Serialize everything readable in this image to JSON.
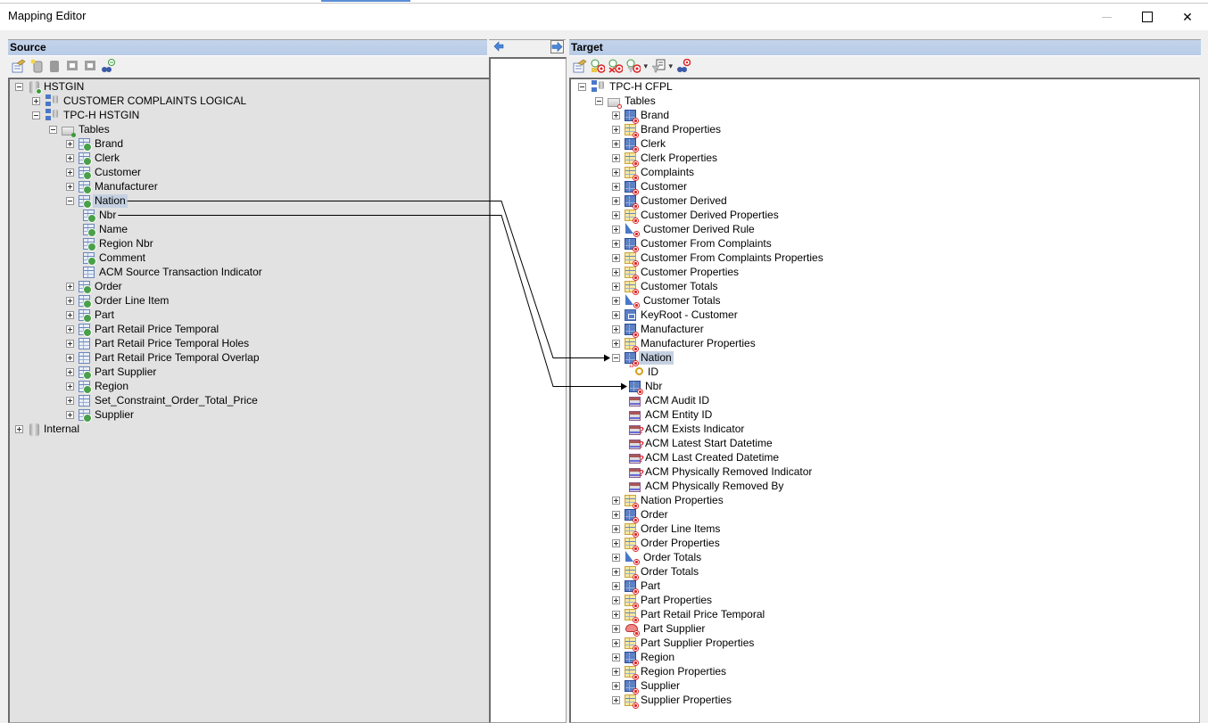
{
  "window": {
    "title": "Mapping Editor",
    "controls": {
      "minimize": "—",
      "maximize": "☐",
      "close": "✕"
    }
  },
  "source": {
    "header": "Source",
    "toolbar": [
      {
        "name": "properties-icon"
      },
      {
        "name": "new-database-icon"
      },
      {
        "name": "database-disabled-icon"
      },
      {
        "name": "map-disabled-icon"
      },
      {
        "name": "unmap-disabled-icon"
      },
      {
        "name": "find-icon"
      }
    ],
    "tree": [
      {
        "label": "HSTGIN",
        "level": 0,
        "expander": "minus",
        "icon": "database"
      },
      {
        "label": "CUSTOMER COMPLAINTS LOGICAL",
        "level": 1,
        "expander": "plus",
        "icon": "model"
      },
      {
        "label": "TPC-H HSTGIN",
        "level": 1,
        "expander": "minus",
        "icon": "model"
      },
      {
        "label": "Tables",
        "level": 2,
        "expander": "minus",
        "icon": "folder-green"
      },
      {
        "label": "Brand",
        "level": 3,
        "expander": "plus",
        "icon": "table-arrow"
      },
      {
        "label": "Clerk",
        "level": 3,
        "expander": "plus",
        "icon": "table-arrow"
      },
      {
        "label": "Customer",
        "level": 3,
        "expander": "plus",
        "icon": "table-arrow"
      },
      {
        "label": "Manufacturer",
        "level": 3,
        "expander": "plus",
        "icon": "table-arrow"
      },
      {
        "label": "Nation",
        "level": 3,
        "expander": "minus",
        "icon": "table-arrow",
        "selected": true
      },
      {
        "label": "Nbr",
        "level": 4,
        "expander": "none",
        "icon": "table-arrow"
      },
      {
        "label": "Name",
        "level": 4,
        "expander": "none",
        "icon": "table-arrow"
      },
      {
        "label": "Region Nbr",
        "level": 4,
        "expander": "none",
        "icon": "table-arrow"
      },
      {
        "label": "Comment",
        "level": 4,
        "expander": "none",
        "icon": "table-arrow"
      },
      {
        "label": "ACM Source Transaction Indicator",
        "level": 4,
        "expander": "none",
        "icon": "table"
      },
      {
        "label": "Order",
        "level": 3,
        "expander": "plus",
        "icon": "table-arrow"
      },
      {
        "label": "Order Line Item",
        "level": 3,
        "expander": "plus",
        "icon": "table-arrow"
      },
      {
        "label": "Part",
        "level": 3,
        "expander": "plus",
        "icon": "table-arrow"
      },
      {
        "label": "Part Retail Price Temporal",
        "level": 3,
        "expander": "plus",
        "icon": "table-arrow"
      },
      {
        "label": "Part Retail Price Temporal Holes",
        "level": 3,
        "expander": "plus",
        "icon": "table"
      },
      {
        "label": "Part Retail Price Temporal Overlap",
        "level": 3,
        "expander": "plus",
        "icon": "table"
      },
      {
        "label": "Part Supplier",
        "level": 3,
        "expander": "plus",
        "icon": "table-arrow"
      },
      {
        "label": "Region",
        "level": 3,
        "expander": "plus",
        "icon": "table-arrow"
      },
      {
        "label": "Set_Constraint_Order_Total_Price",
        "level": 3,
        "expander": "plus",
        "icon": "table"
      },
      {
        "label": "Supplier",
        "level": 3,
        "expander": "plus",
        "icon": "table-arrow"
      },
      {
        "label": "Internal",
        "level": 0,
        "expander": "plus",
        "icon": "database-plain"
      }
    ]
  },
  "middle": {
    "arrow_left": "map-left-icon",
    "arrow_right": "map-right-icon"
  },
  "target": {
    "header": "Target",
    "toolbar": [
      {
        "name": "properties-icon"
      },
      {
        "name": "add-target-icon"
      },
      {
        "name": "remove-target-icon"
      },
      {
        "name": "filter-target-icon",
        "dropdown": true
      },
      {
        "name": "filter-list-icon",
        "dropdown": true
      },
      {
        "name": "find-target-icon"
      }
    ],
    "tree": [
      {
        "label": "TPC-H CFPL",
        "level": 0,
        "expander": "minus",
        "icon": "model"
      },
      {
        "label": "Tables",
        "level": 1,
        "expander": "minus",
        "icon": "folder-red"
      },
      {
        "label": "Brand",
        "level": 2,
        "expander": "plus",
        "icon": "table-blue"
      },
      {
        "label": "Brand Properties",
        "level": 2,
        "expander": "plus",
        "icon": "table-yellow"
      },
      {
        "label": "Clerk",
        "level": 2,
        "expander": "plus",
        "icon": "table-blue"
      },
      {
        "label": "Clerk Properties",
        "level": 2,
        "expander": "plus",
        "icon": "table-yellow"
      },
      {
        "label": "Complaints",
        "level": 2,
        "expander": "plus",
        "icon": "table-yellow"
      },
      {
        "label": "Customer",
        "level": 2,
        "expander": "plus",
        "icon": "table-blue"
      },
      {
        "label": "Customer Derived",
        "level": 2,
        "expander": "plus",
        "icon": "table-blue"
      },
      {
        "label": "Customer Derived Properties",
        "level": 2,
        "expander": "plus",
        "icon": "table-yellow"
      },
      {
        "label": "Customer Derived Rule",
        "level": 2,
        "expander": "plus",
        "icon": "rule"
      },
      {
        "label": "Customer From Complaints",
        "level": 2,
        "expander": "plus",
        "icon": "table-blue"
      },
      {
        "label": "Customer From Complaints Properties",
        "level": 2,
        "expander": "plus",
        "icon": "table-yellow"
      },
      {
        "label": "Customer Properties",
        "level": 2,
        "expander": "plus",
        "icon": "table-yellow"
      },
      {
        "label": "Customer Totals",
        "level": 2,
        "expander": "plus",
        "icon": "table-yellow"
      },
      {
        "label": "Customer Totals",
        "level": 2,
        "expander": "plus",
        "icon": "rule"
      },
      {
        "label": "KeyRoot - Customer",
        "level": 2,
        "expander": "plus",
        "icon": "keyroot"
      },
      {
        "label": "Manufacturer",
        "level": 2,
        "expander": "plus",
        "icon": "table-blue"
      },
      {
        "label": "Manufacturer Properties",
        "level": 2,
        "expander": "plus",
        "icon": "table-yellow"
      },
      {
        "label": "Nation",
        "level": 2,
        "expander": "minus",
        "icon": "table-blue",
        "selected": true
      },
      {
        "label": "ID",
        "level": 3,
        "expander": "none",
        "icon": "key"
      },
      {
        "label": "Nbr",
        "level": 3,
        "expander": "none",
        "icon": "table-blue"
      },
      {
        "label": "ACM Audit ID",
        "level": 3,
        "expander": "none",
        "icon": "attr"
      },
      {
        "label": "ACM Entity ID",
        "level": 3,
        "expander": "none",
        "icon": "attr"
      },
      {
        "label": "ACM Exists Indicator",
        "level": 3,
        "expander": "none",
        "icon": "attr-q"
      },
      {
        "label": "ACM Latest Start Datetime",
        "level": 3,
        "expander": "none",
        "icon": "attr-q"
      },
      {
        "label": "ACM Last Created Datetime",
        "level": 3,
        "expander": "none",
        "icon": "attr-q"
      },
      {
        "label": "ACM Physically Removed Indicator",
        "level": 3,
        "expander": "none",
        "icon": "attr-q"
      },
      {
        "label": "ACM Physically Removed By",
        "level": 3,
        "expander": "none",
        "icon": "attr"
      },
      {
        "label": "Nation Properties",
        "level": 2,
        "expander": "plus",
        "icon": "table-yellow"
      },
      {
        "label": "Order",
        "level": 2,
        "expander": "plus",
        "icon": "table-blue"
      },
      {
        "label": "Order Line Items",
        "level": 2,
        "expander": "plus",
        "icon": "table-yellow"
      },
      {
        "label": "Order Properties",
        "level": 2,
        "expander": "plus",
        "icon": "table-yellow"
      },
      {
        "label": "Order Totals",
        "level": 2,
        "expander": "plus",
        "icon": "rule"
      },
      {
        "label": "Order Totals",
        "level": 2,
        "expander": "plus",
        "icon": "table-yellow"
      },
      {
        "label": "Part",
        "level": 2,
        "expander": "plus",
        "icon": "table-blue"
      },
      {
        "label": "Part Properties",
        "level": 2,
        "expander": "plus",
        "icon": "table-yellow"
      },
      {
        "label": "Part Retail Price Temporal",
        "level": 2,
        "expander": "plus",
        "icon": "table-yellow"
      },
      {
        "label": "Part Supplier",
        "level": 2,
        "expander": "plus",
        "icon": "supplier"
      },
      {
        "label": "Part Supplier Properties",
        "level": 2,
        "expander": "plus",
        "icon": "table-yellow"
      },
      {
        "label": "Region",
        "level": 2,
        "expander": "plus",
        "icon": "table-blue"
      },
      {
        "label": "Region Properties",
        "level": 2,
        "expander": "plus",
        "icon": "table-yellow"
      },
      {
        "label": "Supplier",
        "level": 2,
        "expander": "plus",
        "icon": "table-blue"
      },
      {
        "label": "Supplier Properties",
        "level": 2,
        "expander": "plus",
        "icon": "table-yellow"
      }
    ]
  },
  "mappings": [
    {
      "from": "Nation",
      "to": "Nation"
    },
    {
      "from": "Nbr",
      "to": "Nbr"
    }
  ]
}
